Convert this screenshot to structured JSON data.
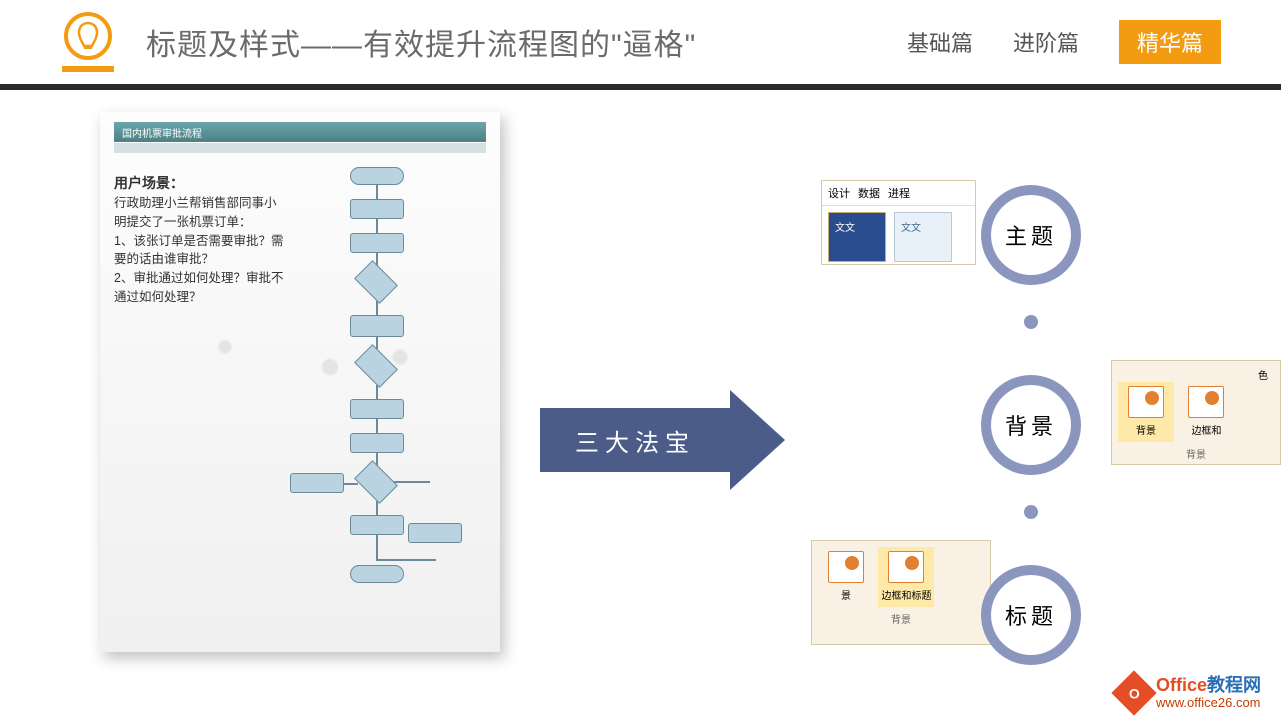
{
  "header": {
    "title": "标题及样式——有效提升流程图的\"逼格\"",
    "nav": {
      "basic": "基础篇",
      "advanced": "进阶篇",
      "essence": "精华篇"
    }
  },
  "flowchart_page": {
    "title": "国内机票审批流程",
    "scenario_heading": "用户场景：",
    "scenario_body": "行政助理小兰帮销售部同事小明提交了一张机票订单：\n1、该张订单是否需要审批？需要的话由谁审批？\n2、审批通过如何处理？审批不通过如何处理？"
  },
  "arrow_text": "三大法宝",
  "treasures": {
    "theme": {
      "label": "主题",
      "tabs": {
        "design": "设计",
        "data": "数据",
        "process": "进程"
      },
      "thumb_text": "文文"
    },
    "background": {
      "label": "背景",
      "btn1": "背景",
      "btn2": "边框和",
      "color": "色",
      "group": "背景"
    },
    "title": {
      "label": "标题",
      "btn1": "景",
      "btn2": "边框和标题",
      "group": "背景"
    }
  },
  "watermark": {
    "brand_colored": "Office",
    "brand_rest": "教程网",
    "url": "www.office26.com",
    "icon_letter": "O"
  }
}
